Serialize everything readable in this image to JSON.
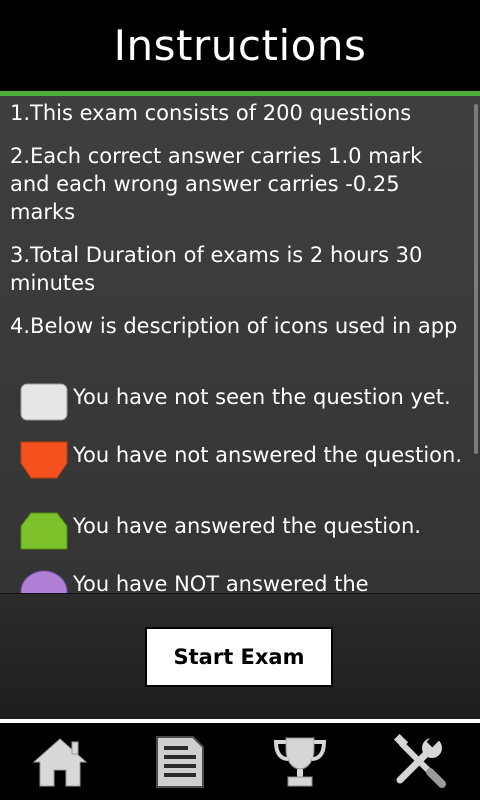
{
  "header": {
    "title": "Instructions"
  },
  "instructions": [
    "1.This exam consists of 200 questions",
    "2.Each correct answer carries 1.0 mark and each wrong answer carries -0.25 marks",
    "3.Total Duration of exams is 2 hours 30 minutes",
    "4.Below is description of icons used in app"
  ],
  "legend": [
    {
      "icon": "white-square-icon",
      "color": "#e6e6e6",
      "label": "You have not seen the question yet."
    },
    {
      "icon": "orange-shield-icon",
      "color": "#f4511e",
      "label": "You have not answered the question."
    },
    {
      "icon": "green-hexagon-icon",
      "color": "#7cc22b",
      "label": "You have answered the question."
    },
    {
      "icon": "purple-circle-icon",
      "color": "#b07fd6",
      "label": "You have NOT answered the question."
    }
  ],
  "actions": {
    "start_label": "Start Exam"
  },
  "tabbar": [
    {
      "name": "home",
      "icon": "home-icon"
    },
    {
      "name": "document",
      "icon": "document-icon"
    },
    {
      "name": "trophy",
      "icon": "trophy-icon"
    },
    {
      "name": "settings",
      "icon": "tools-icon"
    }
  ],
  "colors": {
    "accent": "#4caf3a",
    "background": "#3a3a3a"
  }
}
